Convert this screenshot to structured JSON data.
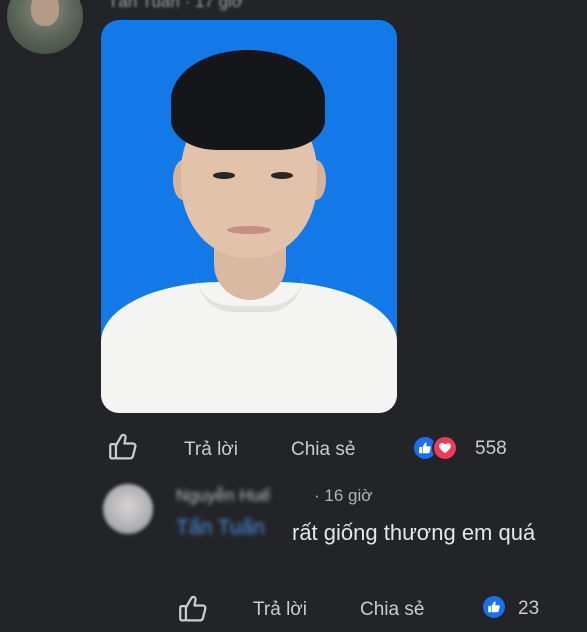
{
  "top_comment": {
    "author": "Tấn Tuấn",
    "time": "17 giờ",
    "actions": {
      "reply": "Trả lời",
      "share": "Chia sẻ"
    },
    "reaction_count": "558"
  },
  "reply_comment": {
    "author": "Nguyễn Huế",
    "separator": "·",
    "time": "16 giờ",
    "mention": "Tấn Tuấn",
    "text": "rất giống thương em quá",
    "actions": {
      "reply": "Trả lời",
      "share": "Chia sẻ"
    },
    "reaction_count": "23"
  },
  "colors": {
    "background": "#232427",
    "like_blue": "#1a6ff0",
    "love_red": "#f03a57",
    "mention_blue": "#4b8fe6"
  },
  "icons": [
    "thumbs-up-outline-icon",
    "like-reaction-icon",
    "love-reaction-icon"
  ]
}
